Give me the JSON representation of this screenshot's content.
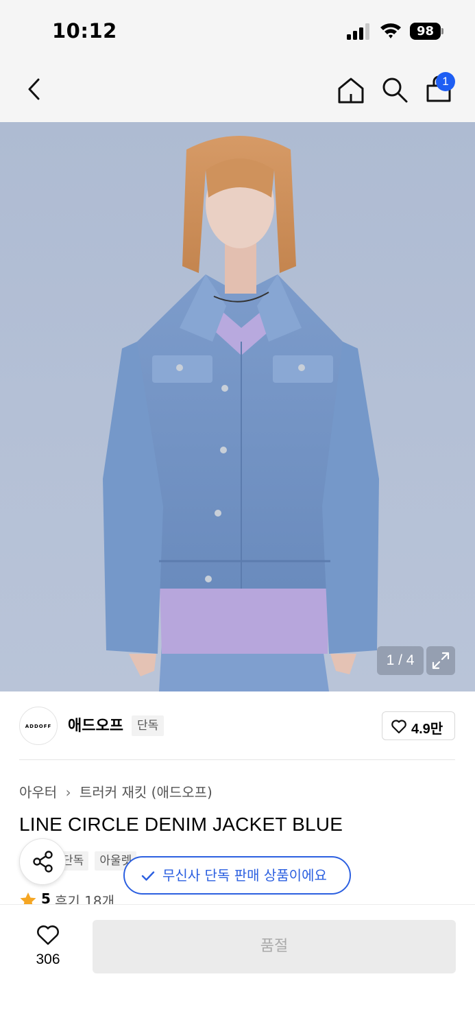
{
  "status_bar": {
    "time": "10:12",
    "battery": "98"
  },
  "nav": {
    "cart_count": "1"
  },
  "gallery": {
    "counter": "1 / 4"
  },
  "brand": {
    "logo_text": "ADDOFF",
    "name": "애드오프",
    "badge": "단독",
    "likes": "4.9만"
  },
  "product": {
    "breadcrumb": [
      "아우터",
      "트러커 재킷 (애드오프)"
    ],
    "breadcrumb_sep": "›",
    "title": "LINE CIRCLE DENIM JACKET BLUE",
    "tags": [
      "단독",
      "아울렛"
    ],
    "rating": "5",
    "review": "후기 18개"
  },
  "banner": {
    "text": "무신사 단독 판매 상품이에요"
  },
  "bottom": {
    "wish_count": "306",
    "soldout_label": "품절"
  },
  "colors": {
    "accent": "#2b5fe0",
    "badge": "#1e5ef3",
    "star": "#f5a623",
    "disabled": "#ebebeb"
  },
  "icons": [
    "back-icon",
    "home-icon",
    "search-icon",
    "cart-icon",
    "expand-icon",
    "heart-icon",
    "share-icon",
    "check-icon",
    "star-icon"
  ]
}
